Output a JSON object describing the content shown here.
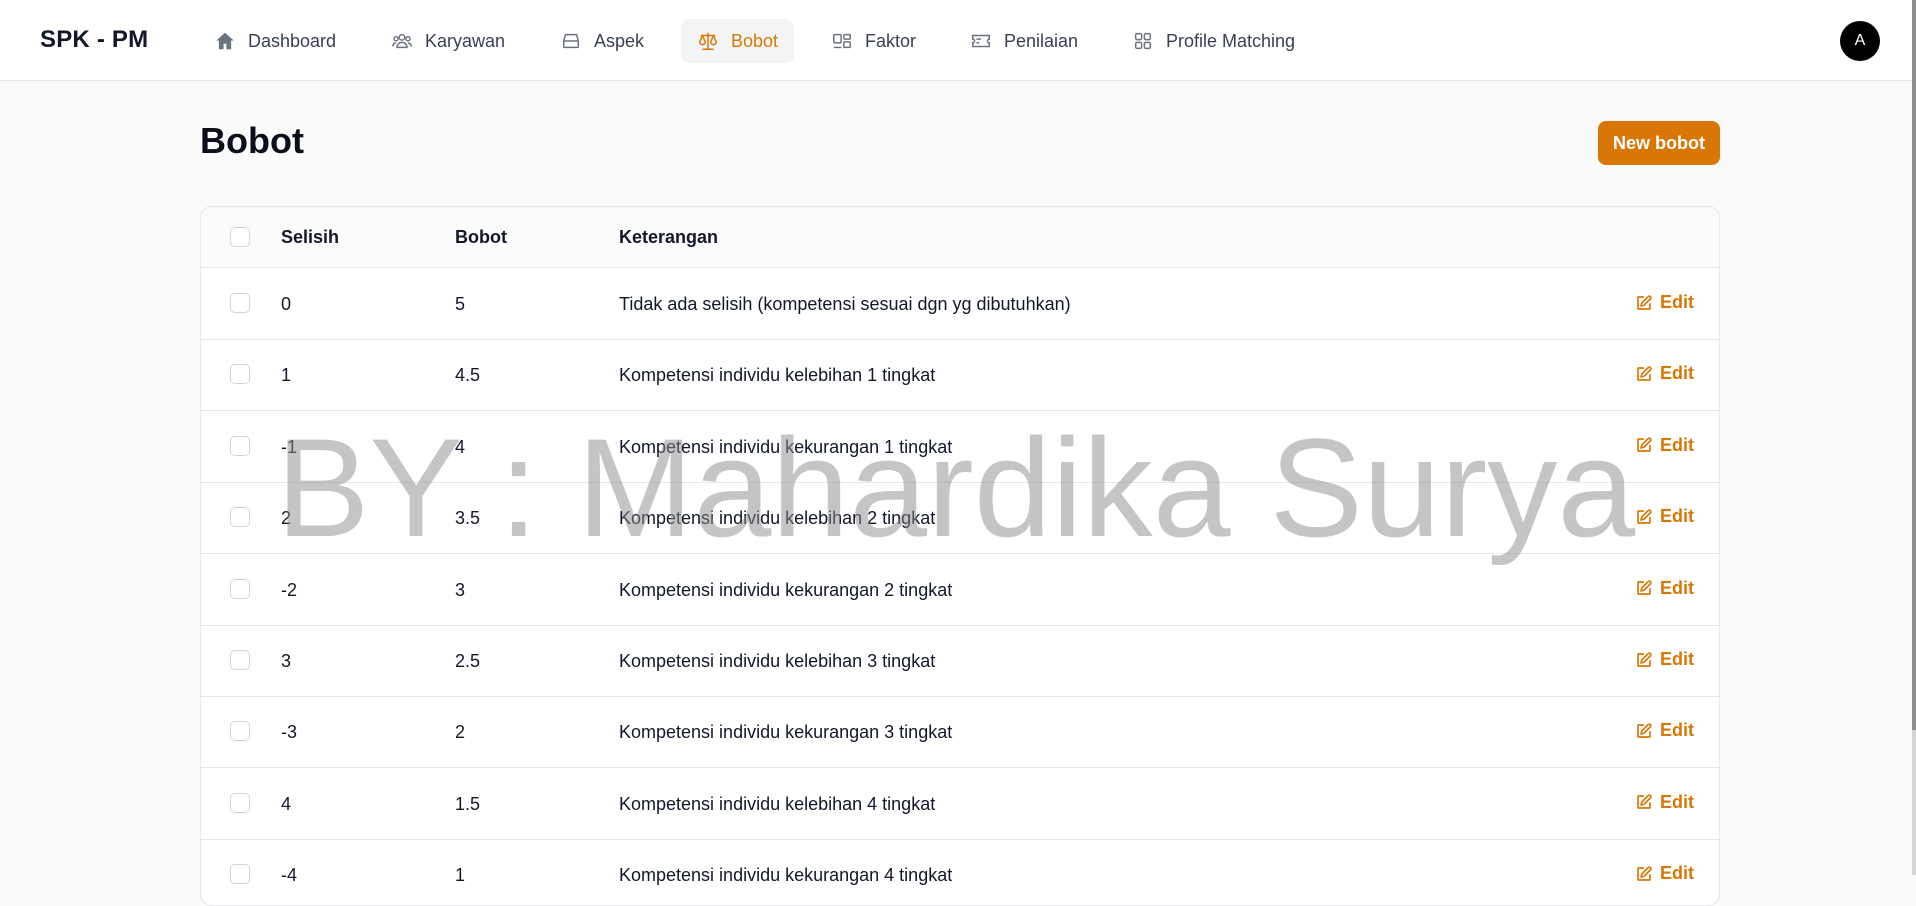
{
  "app": {
    "brand": "SPK - PM",
    "avatar_initial": "A"
  },
  "nav": [
    {
      "label": "Dashboard",
      "icon": "home-icon",
      "active": false
    },
    {
      "label": "Karyawan",
      "icon": "users-icon",
      "active": false
    },
    {
      "label": "Aspek",
      "icon": "inbox-stack-icon",
      "active": false
    },
    {
      "label": "Bobot",
      "icon": "scale-icon",
      "active": true
    },
    {
      "label": "Faktor",
      "icon": "square-split-icon",
      "active": false
    },
    {
      "label": "Penilaian",
      "icon": "ticket-icon",
      "active": false
    },
    {
      "label": "Profile Matching",
      "icon": "squares-grid-icon",
      "active": false
    }
  ],
  "page": {
    "title": "Bobot",
    "new_button": "New bobot"
  },
  "table": {
    "columns": [
      "Selisih",
      "Bobot",
      "Keterangan"
    ],
    "edit_label": "Edit",
    "rows": [
      {
        "selisih": "0",
        "bobot": "5",
        "keterangan": "Tidak ada selisih (kompetensi sesuai dgn yg dibutuhkan)"
      },
      {
        "selisih": "1",
        "bobot": "4.5",
        "keterangan": "Kompetensi individu kelebihan 1 tingkat"
      },
      {
        "selisih": "-1",
        "bobot": "4",
        "keterangan": "Kompetensi individu kekurangan 1 tingkat"
      },
      {
        "selisih": "2",
        "bobot": "3.5",
        "keterangan": "Kompetensi individu kelebihan 2 tingkat"
      },
      {
        "selisih": "-2",
        "bobot": "3",
        "keterangan": "Kompetensi individu kekurangan 2 tingkat"
      },
      {
        "selisih": "3",
        "bobot": "2.5",
        "keterangan": "Kompetensi individu kelebihan 3 tingkat"
      },
      {
        "selisih": "-3",
        "bobot": "2",
        "keterangan": "Kompetensi individu kekurangan 3 tingkat"
      },
      {
        "selisih": "4",
        "bobot": "1.5",
        "keterangan": "Kompetensi individu kelebihan 4 tingkat"
      },
      {
        "selisih": "-4",
        "bobot": "1",
        "keterangan": "Kompetensi individu kekurangan 4 tingkat"
      }
    ]
  },
  "watermark": "BY : Mahardika Surya",
  "colors": {
    "accent": "#d97706",
    "border": "#e5e7eb",
    "background": "#fafafa"
  }
}
